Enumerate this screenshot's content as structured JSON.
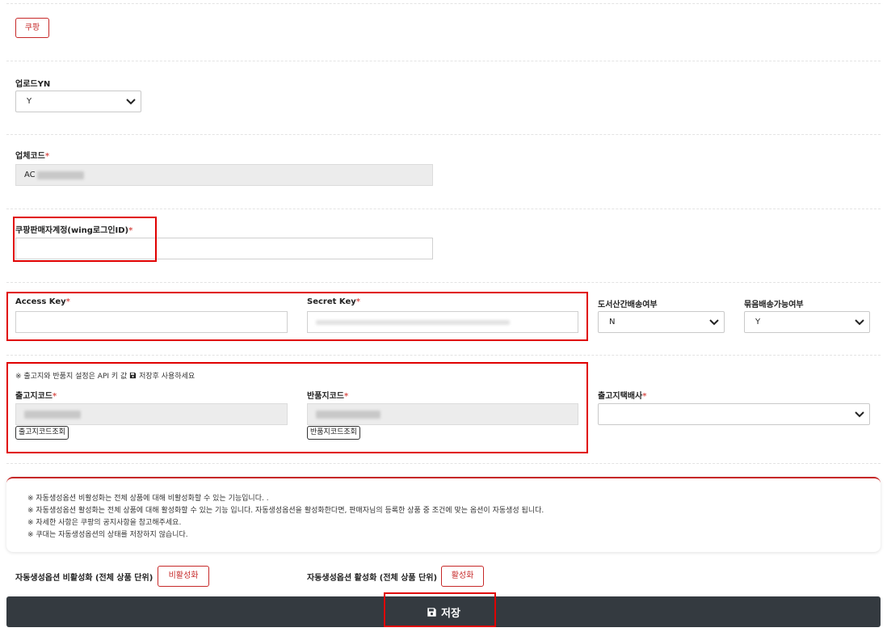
{
  "coupang_button": "쿠팡",
  "upload": {
    "label": "업로드YN",
    "value": "Y"
  },
  "company_code": {
    "label": "업체코드",
    "required": "*",
    "value_prefix": "AC"
  },
  "seller_account": {
    "label": "쿠팡판매자계정(wing로그인ID)",
    "required": "*",
    "value": ""
  },
  "access_key": {
    "label": "Access Key",
    "required": "*",
    "value": ""
  },
  "secret_key": {
    "label": "Secret Key",
    "required": "*"
  },
  "book_shipping": {
    "label": "도서산간배송여부",
    "value": "N"
  },
  "bundle_shipping": {
    "label": "묶음배송가능여부",
    "value": "Y"
  },
  "address_notice": "※ 출고지와 반품지 설정은 API 키 값",
  "address_notice_save": "저장후 사용하세요",
  "shipping_place": {
    "label": "출고지코드",
    "required": "*",
    "lookup_button": "출고지코드조회"
  },
  "return_place": {
    "label": "반품지코드",
    "required": "*",
    "lookup_button": "반품지코드조회"
  },
  "courier": {
    "label": "출고지택배사",
    "required": "*",
    "value": ""
  },
  "notices": [
    "※ 자동생성옵션 비활성화는 전체 상품에 대해 비활성화할 수 있는 기능입니다. .",
    "※ 자동생성옵션 활성화는 전체 상품에 대해 활성화할 수 있는 기능 입니다. 자동생성옵션을 활성화한다면, 판매자님의 등록한 상품 중 조건에 맞는 옵션이 자동생성 됩니다.",
    "※ 자세한 사항은 쿠팡의 공지사항을 참고해주세요.",
    "※ 쿠대는 자동생성옵션의 상태를 저장하지 않습니다."
  ],
  "auto_option_disable": {
    "label": "자동생성옵션 비활성화 (전체 상품 단위)",
    "button": "비활성화"
  },
  "auto_option_enable": {
    "label": "자동생성옵션 활성화 (전체 상품 단위)",
    "button": "활성화"
  },
  "save_button": "저장",
  "colors": {
    "accent_red": "#c62828",
    "highlight_red": "#e00000",
    "save_bar": "#343a40"
  }
}
